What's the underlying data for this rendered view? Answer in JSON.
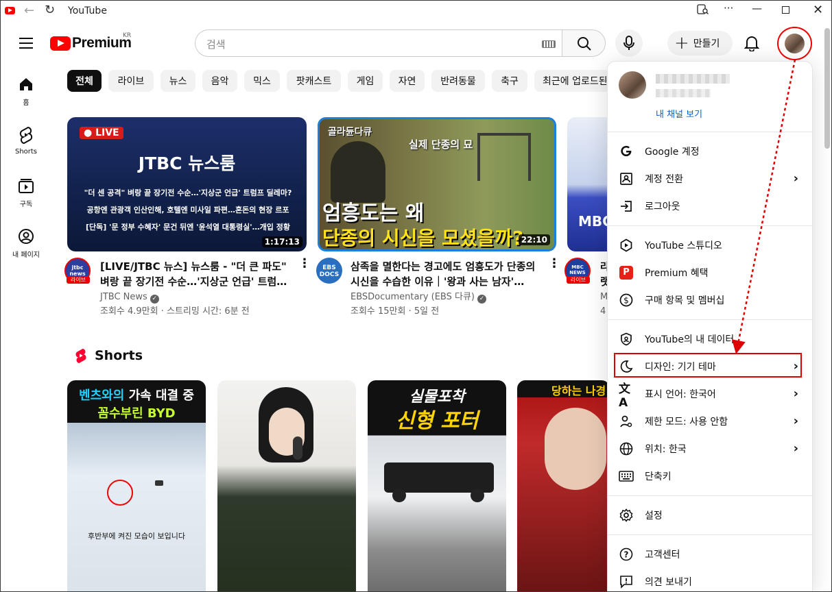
{
  "window": {
    "title": "YouTube"
  },
  "header": {
    "logo_text": "Premium",
    "logo_region": "KR",
    "search_placeholder": "검색",
    "create_label": "만들기"
  },
  "sidebar": [
    {
      "label": "홈",
      "icon": "home-icon"
    },
    {
      "label": "Shorts",
      "icon": "shorts-icon"
    },
    {
      "label": "구독",
      "icon": "subscriptions-icon"
    },
    {
      "label": "내 페이지",
      "icon": "profile-icon"
    }
  ],
  "chips": [
    "전체",
    "라이브",
    "뉴스",
    "음악",
    "믹스",
    "팟캐스트",
    "게임",
    "자연",
    "반려동물",
    "축구",
    "최근에 업로드된"
  ],
  "videos": [
    {
      "thumb_badge": "LIVE",
      "thumb_brand": "JTBC 뉴스룸",
      "thumb_lines": [
        "\"더 센 공격\" 벼랑 끝 장기전 수순…'지상군 언급' 트럼프 딜레마?",
        "공항엔 관광객 인산인해, 호텔엔 미사일 파편…혼돈의 현장 르포",
        "[단독] '문 정부 수혜자' 문건 뒤엔 '윤석열 대통령실'…개입 정황"
      ],
      "duration": "1:17:13",
      "channel_badge": "라이브",
      "channel_logo": "jtbc news",
      "title": "[LIVE/JTBC 뉴스] 뉴스룸 - \"더 큰 파도\" 벼랑 끝 장기전 수순…'지상군 언급' 트럼…",
      "channel": "JTBC News",
      "meta": "조회수 4.9만회 · 스트리밍 시간: 6분 전"
    },
    {
      "thumb_tag": "골라듄다큐",
      "thumb_caption": "실제 단종의 묘",
      "thumb_line1": "엄흥도는 왜",
      "thumb_line2": "단종의 시신을 모셨을까?",
      "duration": "22:10",
      "channel_logo": "EBS DOCS",
      "title": "삼족을 멸한다는 경고에도 엄흥도가 단종의 시신을 수습한 이유｜'왕과 사는 남자'…",
      "channel": "EBSDocumentary (EBS 다큐)",
      "meta": "조회수 15만회 · 5일 전"
    },
    {
      "thumb_text": "MBC 뉴스데",
      "channel_badge": "라이브",
      "channel_logo": "MBC NEWS",
      "title_partial": "라",
      "title_partial2": "랫",
      "meta_partial": "M",
      "meta_partial2": "4"
    }
  ],
  "shorts_section": {
    "title": "Shorts"
  },
  "shorts": [
    {
      "line1a": "벤츠와의",
      "line1b": "가속 대결 중",
      "line2": "꼼수부린 BYD",
      "caption": "후반부에 켜진 모습이 보입니다"
    },
    {},
    {
      "line1": "실물포착",
      "line2": "신형 포터"
    },
    {
      "line1": "당하는 나경"
    }
  ],
  "account_menu": {
    "channel_link": "내 채널 보기",
    "groups": [
      [
        {
          "label": "Google 계정",
          "icon": "google-icon",
          "chevron": false
        },
        {
          "label": "계정 전환",
          "icon": "switch-account-icon",
          "chevron": true
        },
        {
          "label": "로그아웃",
          "icon": "sign-out-icon",
          "chevron": false
        }
      ],
      [
        {
          "label": "YouTube 스튜디오",
          "icon": "studio-icon",
          "chevron": false
        },
        {
          "label": "Premium 혜택",
          "icon": "premium-icon",
          "chevron": false
        },
        {
          "label": "구매 항목 및 멤버십",
          "icon": "purchases-icon",
          "chevron": false
        }
      ],
      [
        {
          "label": "YouTube의 내 데이터",
          "icon": "shield-icon",
          "chevron": false
        },
        {
          "label": "디자인: 기기 테마",
          "icon": "moon-icon",
          "chevron": true
        },
        {
          "label": "표시 언어: 한국어",
          "icon": "translate-icon",
          "chevron": true
        },
        {
          "label": "제한 모드: 사용 안함",
          "icon": "restricted-icon",
          "chevron": true
        },
        {
          "label": "위치: 한국",
          "icon": "globe-icon",
          "chevron": true
        },
        {
          "label": "단축키",
          "icon": "keyboard-icon",
          "chevron": false
        }
      ],
      [
        {
          "label": "설정",
          "icon": "gear-icon",
          "chevron": false
        }
      ],
      [
        {
          "label": "고객센터",
          "icon": "help-icon",
          "chevron": false
        },
        {
          "label": "의견 보내기",
          "icon": "feedback-icon",
          "chevron": false
        }
      ]
    ]
  },
  "colors": {
    "brand": "#ff0000",
    "annotation": "#dd0000",
    "premium_badge": "#e62117"
  }
}
